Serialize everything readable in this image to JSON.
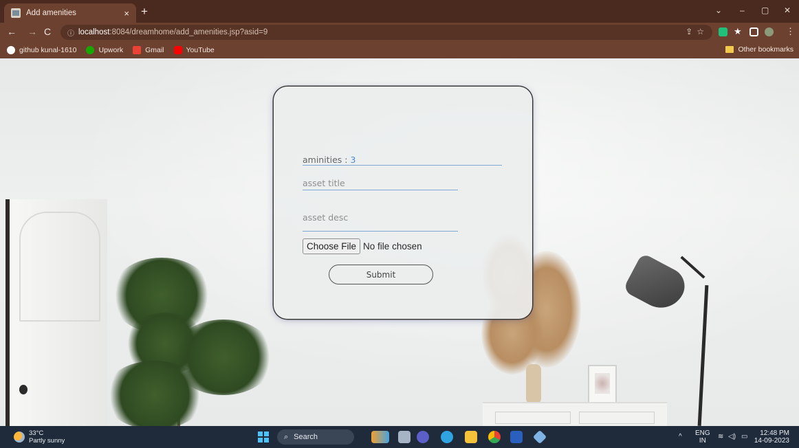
{
  "browser": {
    "tab_title": "Add amenities",
    "tab_close": "×",
    "new_tab": "+",
    "window_controls": {
      "minimize": "–",
      "maximize": "▢",
      "close": "✕",
      "tab_search": "⌄"
    },
    "url_host": "localhost",
    "url_path": ":8084/dreamhome/add_amenities.jsp?asid=9",
    "bookmarks": [
      {
        "label": "github kunal-1610",
        "icon": "github-icon",
        "color": "#ffffff"
      },
      {
        "label": "Upwork",
        "icon": "upwork-icon",
        "color": "#14a800"
      },
      {
        "label": "Gmail",
        "icon": "gmail-icon",
        "color": "#ea4335"
      },
      {
        "label": "YouTube",
        "icon": "youtube-icon",
        "color": "#ff0000"
      }
    ],
    "other_bookmarks": "Other bookmarks"
  },
  "form": {
    "amenities_label": "aminities :",
    "amenities_value": "3",
    "title_placeholder": "asset title",
    "desc_placeholder": "asset desc",
    "file_button": "Choose File",
    "file_status": "No file chosen",
    "submit_label": "Submit"
  },
  "taskbar": {
    "temperature": "33°C",
    "condition": "Partly sunny",
    "search_label": "Search",
    "lang_top": "ENG",
    "lang_bottom": "IN",
    "time": "12:48 PM",
    "date": "14-09-2023"
  },
  "colors": {
    "chrome": "#6d4130",
    "accent_blue": "#4a8bd4",
    "taskbar": "#1f2a3a"
  }
}
